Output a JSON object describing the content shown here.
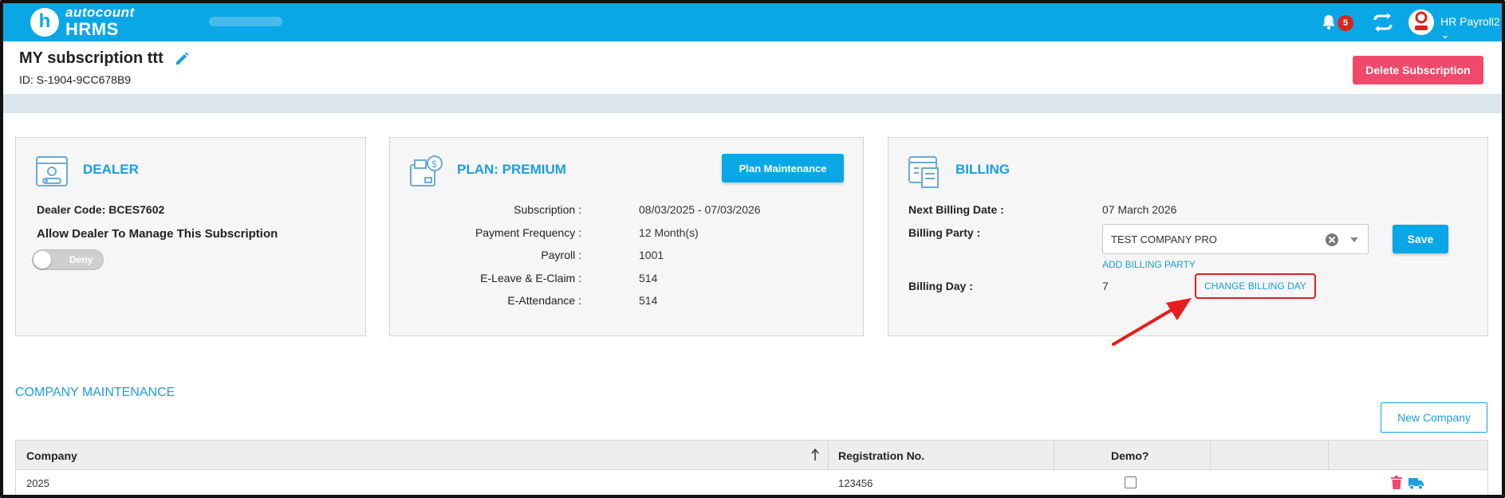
{
  "app": {
    "logo_letter": "h",
    "brand_top": "autocount",
    "brand_bottom": "HRMS",
    "notifications_count": "5",
    "user_name": "HR Payroll2",
    "accent_color": "#0aa7e6"
  },
  "header": {
    "title": "MY subscription ttt",
    "subscription_id": "ID: S-1904-9CC678B9",
    "delete_button": "Delete Subscription"
  },
  "dealer": {
    "title": "DEALER",
    "dealer_code": "Dealer Code: BCES7602",
    "allow_label": "Allow Dealer To Manage This Subscription",
    "toggle_text": "Deny",
    "icon": "dealer-folder-icon"
  },
  "plan": {
    "title": "PLAN: PREMIUM",
    "maintenance_button": "Plan Maintenance",
    "icon": "plan-payment-icon",
    "fields": [
      {
        "label": "Subscription :",
        "value": "08/03/2025 - 07/03/2026"
      },
      {
        "label": "Payment Frequency :",
        "value": "12 Month(s)"
      },
      {
        "label": "Payroll :",
        "value": "1001"
      },
      {
        "label": "E-Leave & E-Claim :",
        "value": "514"
      },
      {
        "label": "E-Attendance :",
        "value": "514"
      }
    ]
  },
  "billing": {
    "title": "BILLING",
    "icon": "billing-invoice-icon",
    "next_billing_label": "Next Billing Date :",
    "next_billing_value": "07 March 2026",
    "party_label": "Billing Party :",
    "party_value": "TEST COMPANY PRO",
    "add_party_link": "ADD BILLING PARTY",
    "save_button": "Save",
    "day_label": "Billing Day :",
    "day_value": "7",
    "change_day_link": "CHANGE BILLING DAY"
  },
  "company_section": {
    "title": "COMPANY MAINTENANCE",
    "new_button": "New Company",
    "columns": [
      "Company",
      "Registration No.",
      "Demo?"
    ],
    "rows": [
      {
        "company": "2025",
        "registration": "123456",
        "demo": false
      }
    ]
  }
}
